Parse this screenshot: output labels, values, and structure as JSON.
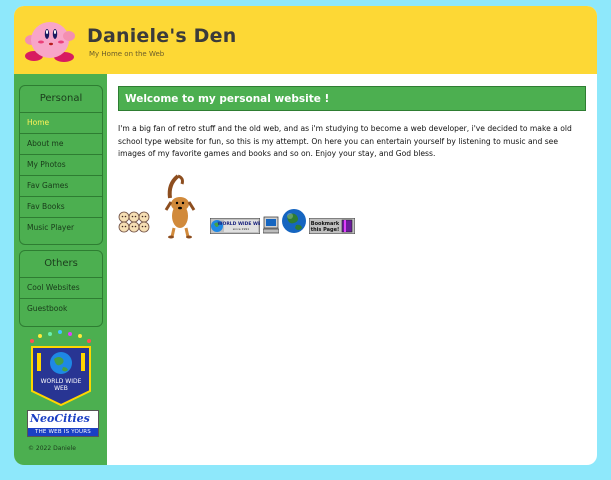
{
  "site": {
    "title": "Daniele's Den",
    "subtitle": "My Home on the Web",
    "icon": "kirby-icon"
  },
  "sidebar": {
    "personal_heading": "Personal",
    "personal_items": [
      {
        "label": "Home",
        "active": true
      },
      {
        "label": "About me"
      },
      {
        "label": "My Photos"
      },
      {
        "label": "Fav Games"
      },
      {
        "label": "Fav Books"
      },
      {
        "label": "Music Player"
      }
    ],
    "others_heading": "Others",
    "others_items": [
      {
        "label": "Cool Websites"
      },
      {
        "label": "Guestbook"
      }
    ],
    "www_badge_text": "WORLD WIDE WEB",
    "neocities_text": "NeoCities",
    "neocities_sub": "THE WEB IS YOURS",
    "copyright": "© 2022 Daniele"
  },
  "main": {
    "welcome": "Welcome to my personal website !",
    "intro": "I'm a big fan of retro stuff and the old web, and as i'm studying to become a web developer, i've decided to make a old school type website for fun, so this is my attempt. On here you can entertain yourself by listening to music and see images of my favorite games and books and so on. Enjoy your stay, and God bless.",
    "gifs": [
      {
        "name": "hamsters-gif"
      },
      {
        "name": "dancing-dog-gif"
      },
      {
        "name": "world-wide-web-button",
        "text": "WORLD WIDE WEB"
      },
      {
        "name": "computer-gif"
      },
      {
        "name": "spinning-globe-gif"
      },
      {
        "name": "bookmark-button",
        "text": "Bookmark this Page!"
      }
    ]
  },
  "colors": {
    "background": "#8ee8fb",
    "header": "#fdd835",
    "green": "#4caf50",
    "active_link": "#fff35a"
  }
}
